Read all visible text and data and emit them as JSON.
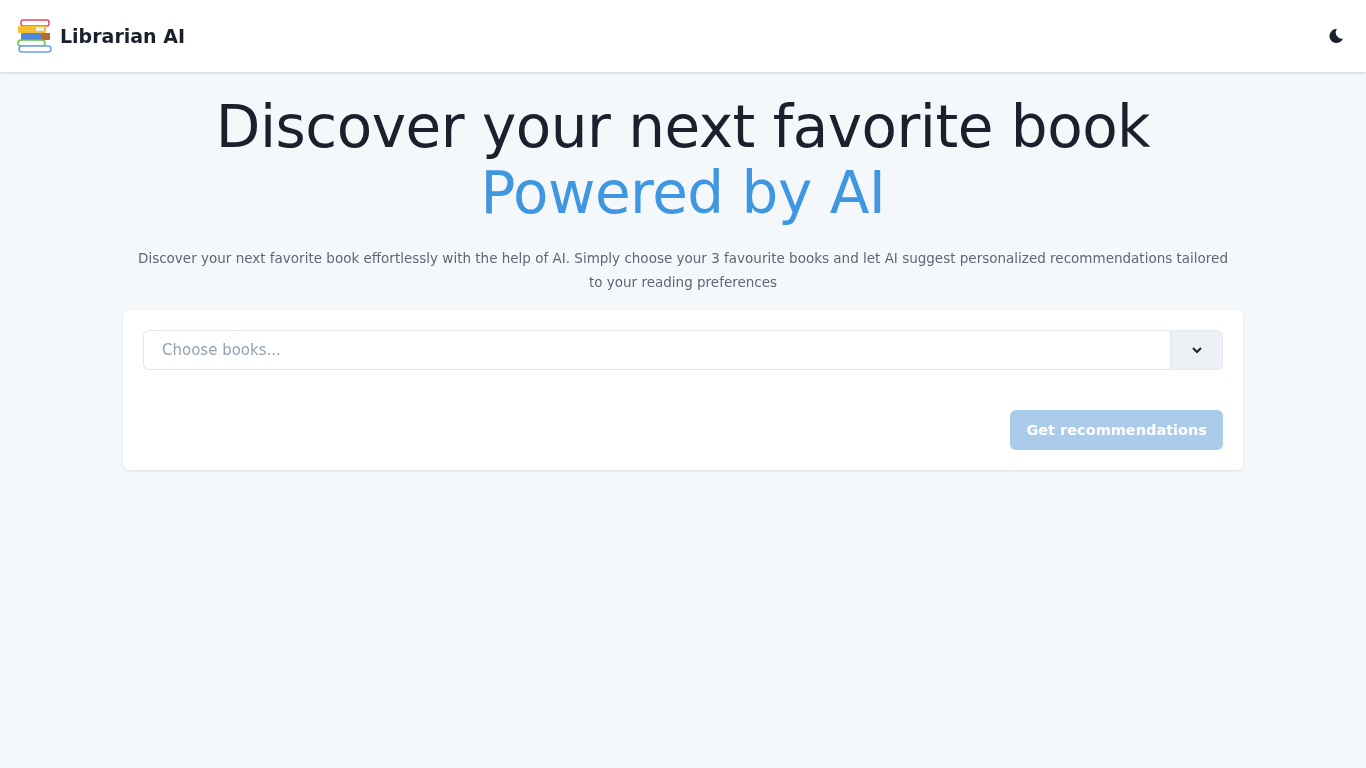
{
  "header": {
    "brand": "Librarian AI"
  },
  "hero": {
    "title": "Discover your next favorite book",
    "highlight": "Powered by AI",
    "description": "Discover your next favorite book effortlessly with the help of AI. Simply choose your 3 favourite books and let AI suggest personalized recommendations tailored to your reading preferences"
  },
  "form": {
    "select": {
      "placeholder": "Choose books..."
    },
    "submit": {
      "label": "Get recommendations",
      "disabled": true
    }
  }
}
